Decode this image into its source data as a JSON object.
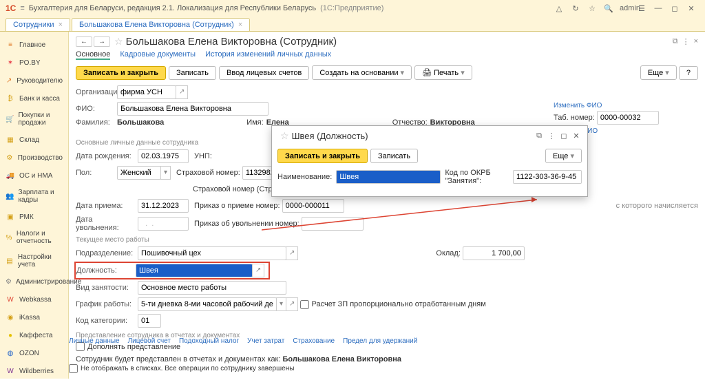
{
  "titlebar": {
    "product": "Бухгалтерия для Беларуси, редакция 2.1. Локализация для Республики Беларусь",
    "suffix": "(1С:Предприятие)",
    "user": "admin"
  },
  "tabs": [
    {
      "label": "Сотрудники"
    },
    {
      "label": "Большакова Елена Викторовна (Сотрудник)"
    }
  ],
  "sidebar": [
    {
      "label": "Главное",
      "icon": "≡",
      "color": "#e07b29"
    },
    {
      "label": "PO.BY",
      "icon": "✶",
      "color": "#e63946"
    },
    {
      "label": "Руководителю",
      "icon": "↗",
      "color": "#e07b29"
    },
    {
      "label": "Банк и касса",
      "icon": "₿",
      "color": "#d4a017"
    },
    {
      "label": "Покупки и продажи",
      "icon": "🛒",
      "color": "#d4a017"
    },
    {
      "label": "Склад",
      "icon": "▦",
      "color": "#d4a017"
    },
    {
      "label": "Производство",
      "icon": "⚙",
      "color": "#d4a017"
    },
    {
      "label": "ОС и НМА",
      "icon": "🚚",
      "color": "#d4a017"
    },
    {
      "label": "Зарплата и кадры",
      "icon": "👥",
      "color": "#d4a017"
    },
    {
      "label": "РМК",
      "icon": "▣",
      "color": "#d4a017"
    },
    {
      "label": "Налоги и отчетность",
      "icon": "%",
      "color": "#d4a017"
    },
    {
      "label": "Настройки учета",
      "icon": "▤",
      "color": "#d4a017"
    },
    {
      "label": "Администрирование",
      "icon": "⚙",
      "color": "#888"
    },
    {
      "label": "Webkassa",
      "icon": "W",
      "color": "#d43"
    },
    {
      "label": "iKassa",
      "icon": "◉",
      "color": "#d4a017"
    },
    {
      "label": "Каффеста",
      "icon": "●",
      "color": "#e6c200"
    },
    {
      "label": "OZON",
      "icon": "◍",
      "color": "#1a5ec8"
    },
    {
      "label": "Wildberries",
      "icon": "W",
      "color": "#7b2d8e"
    }
  ],
  "header": {
    "title": "Большакова Елена Викторовна (Сотрудник)"
  },
  "subtabs": {
    "main": "Основное",
    "kadr": "Кадровые документы",
    "hist": "История изменений личных данных"
  },
  "toolbar": {
    "save_close": "Записать и закрыть",
    "save": "Записать",
    "accounts": "Ввод лицевых счетов",
    "create_on": "Создать на основании",
    "print": "Печать",
    "more": "Еще",
    "help": "?"
  },
  "fields": {
    "org": {
      "label": "Организация:",
      "value": "фирма УСН"
    },
    "fio": {
      "label": "ФИО:",
      "value": "Большакова Елена Викторовна"
    },
    "fam": {
      "label": "Фамилия:",
      "value": "Большакова"
    },
    "name": {
      "label": "Имя:",
      "value": "Елена"
    },
    "patr": {
      "label": "Отчество:",
      "value": "Викторовна"
    },
    "change_fio": "Изменить ФИО",
    "history_fio": "История ФИО",
    "tab_no_label": "Таб. номер:",
    "tab_no": "0000-00032",
    "section_personal": "Основные личные данные сотрудника",
    "dob": {
      "label": "Дата рождения:",
      "value": "02.03.1975"
    },
    "unp": "УНП:",
    "sex": {
      "label": "Пол:",
      "value": "Женский"
    },
    "ins": {
      "label": "Страховой номер:",
      "value": "11329822166"
    },
    "ins2": {
      "label": "Страховой номер (Стравита):",
      "value": ""
    },
    "hired": {
      "label": "Дата приема:",
      "value": "31.12.2023"
    },
    "order": {
      "label": "Приказ о приеме номер:",
      "value": "0000-000011"
    },
    "order_tail": "с которого начисляется",
    "fired": {
      "label": "Дата увольнения:",
      "value": ""
    },
    "fire_order": {
      "label": "Приказ об увольнении номер:",
      "value": ""
    },
    "section_work": "Текущее место работы",
    "dept": {
      "label": "Подразделение:",
      "value": "Пошивочный цех"
    },
    "position": {
      "label": "Должность:",
      "value": "Швея"
    },
    "salary": {
      "label": "Оклад:",
      "value": "1 700,00"
    },
    "employment": {
      "label": "Вид занятости:",
      "value": "Основное место работы"
    },
    "schedule": {
      "label": "График работы:",
      "value": "5-ти дневка 8-ми часовой рабочий день"
    },
    "salary_prop": "Расчет ЗП пропорционально отработанным дням",
    "category": {
      "label": "Код категории:",
      "value": "01"
    },
    "section_repr": "Представление сотрудника в отчетах и документах",
    "fill_repr": "Дополнять представление",
    "repr_text": "Сотрудник будет представлен в отчетах и документах как:",
    "repr_name": "Большакова Елена Викторовна",
    "footer": [
      "Личные данные",
      "Лицевой счет",
      "Подоходный налог",
      "Учет затрат",
      "Страхование",
      "Предел для удержаний"
    ],
    "footer_chk": "Не отображать в списках. Все операции по сотруднику завершены"
  },
  "dialog": {
    "title": "Швея (Должность)",
    "save_close": "Записать и закрыть",
    "save": "Записать",
    "more": "Еще",
    "name_label": "Наименование:",
    "name_value": "Швея",
    "code_label": "Код по ОКРБ \"Занятия\":",
    "code_value": "1122-303-36-9-45"
  }
}
